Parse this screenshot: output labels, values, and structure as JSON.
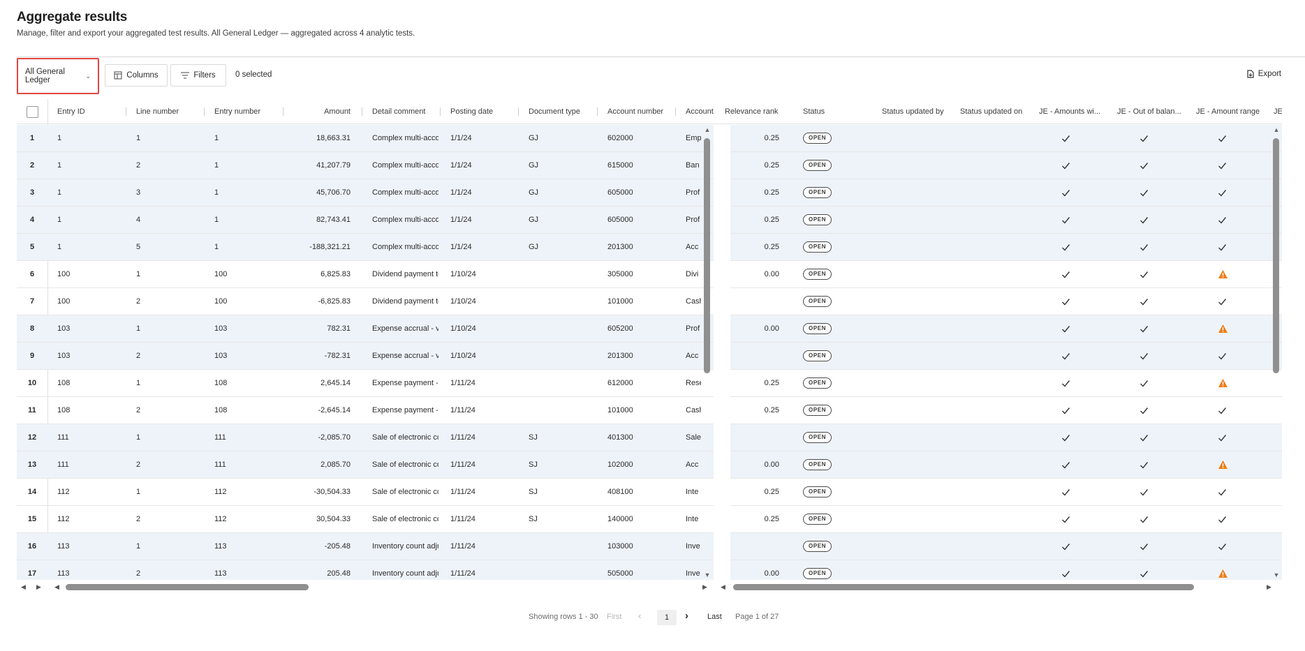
{
  "page": {
    "title": "Aggregate results",
    "subtitle": "Manage, filter and export your aggregated test results. All General Ledger — aggregated across 4 analytic tests."
  },
  "toolbar": {
    "dataset_label": "All General Ledger",
    "columns_label": "Columns",
    "filters_label": "Filters",
    "selected_text": "0 selected",
    "export_label": "Export"
  },
  "columns": [
    "Entry ID",
    "Line number",
    "Entry number",
    "Amount",
    "Detail comment",
    "Posting date",
    "Document type",
    "Account number",
    "Account",
    "Relevance rank",
    "Status",
    "Status updated by",
    "Status updated on",
    "JE - Amounts wi...",
    "JE - Out of balan...",
    "JE - Amount range",
    "JE -"
  ],
  "rows": [
    {
      "n": "1",
      "entry_id": "1",
      "line": "1",
      "entry_no": "1",
      "amount": "18,663.31",
      "detail": "Complex multi-accou",
      "date": "1/1/24",
      "doc": "GJ",
      "acct_no": "602000",
      "acct": "Emp",
      "rank": "0.25",
      "status": "OPEN",
      "t1": "check",
      "t2": "check",
      "t3": "check"
    },
    {
      "n": "2",
      "entry_id": "1",
      "line": "2",
      "entry_no": "1",
      "amount": "41,207.79",
      "detail": "Complex multi-accou",
      "date": "1/1/24",
      "doc": "GJ",
      "acct_no": "615000",
      "acct": "Ban",
      "rank": "0.25",
      "status": "OPEN",
      "t1": "check",
      "t2": "check",
      "t3": "check"
    },
    {
      "n": "3",
      "entry_id": "1",
      "line": "3",
      "entry_no": "1",
      "amount": "45,706.70",
      "detail": "Complex multi-accou",
      "date": "1/1/24",
      "doc": "GJ",
      "acct_no": "605000",
      "acct": "Prof",
      "rank": "0.25",
      "status": "OPEN",
      "t1": "check",
      "t2": "check",
      "t3": "check"
    },
    {
      "n": "4",
      "entry_id": "1",
      "line": "4",
      "entry_no": "1",
      "amount": "82,743.41",
      "detail": "Complex multi-accou",
      "date": "1/1/24",
      "doc": "GJ",
      "acct_no": "605000",
      "acct": "Prof",
      "rank": "0.25",
      "status": "OPEN",
      "t1": "check",
      "t2": "check",
      "t3": "check"
    },
    {
      "n": "5",
      "entry_id": "1",
      "line": "5",
      "entry_no": "1",
      "amount": "-188,321.21",
      "detail": "Complex multi-accou",
      "date": "1/1/24",
      "doc": "GJ",
      "acct_no": "201300",
      "acct": "Acc",
      "rank": "0.25",
      "status": "OPEN",
      "t1": "check",
      "t2": "check",
      "t3": "check"
    },
    {
      "n": "6",
      "entry_id": "100",
      "line": "1",
      "entry_no": "100",
      "amount": "6,825.83",
      "detail": "Dividend payment to",
      "date": "1/10/24",
      "doc": "",
      "acct_no": "305000",
      "acct": "Divi",
      "rank": "0.00",
      "status": "OPEN",
      "t1": "check",
      "t2": "check",
      "t3": "warn"
    },
    {
      "n": "7",
      "entry_id": "100",
      "line": "2",
      "entry_no": "100",
      "amount": "-6,825.83",
      "detail": "Dividend payment to",
      "date": "1/10/24",
      "doc": "",
      "acct_no": "101000",
      "acct": "Cash",
      "rank": "",
      "status": "OPEN",
      "t1": "check",
      "t2": "check",
      "t3": "check"
    },
    {
      "n": "8",
      "entry_id": "103",
      "line": "1",
      "entry_no": "103",
      "amount": "782.31",
      "detail": "Expense accrual - ver",
      "date": "1/10/24",
      "doc": "",
      "acct_no": "605200",
      "acct": "Prof",
      "rank": "0.00",
      "status": "OPEN",
      "t1": "check",
      "t2": "check",
      "t3": "warn"
    },
    {
      "n": "9",
      "entry_id": "103",
      "line": "2",
      "entry_no": "103",
      "amount": "-782.31",
      "detail": "Expense accrual - ver",
      "date": "1/10/24",
      "doc": "",
      "acct_no": "201300",
      "acct": "Acc",
      "rank": "",
      "status": "OPEN",
      "t1": "check",
      "t2": "check",
      "t3": "check"
    },
    {
      "n": "10",
      "entry_id": "108",
      "line": "1",
      "entry_no": "108",
      "amount": "2,645.14",
      "detail": "Expense payment - ve",
      "date": "1/11/24",
      "doc": "",
      "acct_no": "612000",
      "acct": "Rese",
      "rank": "0.25",
      "status": "OPEN",
      "t1": "check",
      "t2": "check",
      "t3": "warn"
    },
    {
      "n": "11",
      "entry_id": "108",
      "line": "2",
      "entry_no": "108",
      "amount": "-2,645.14",
      "detail": "Expense payment - ve",
      "date": "1/11/24",
      "doc": "",
      "acct_no": "101000",
      "acct": "Cash",
      "rank": "0.25",
      "status": "OPEN",
      "t1": "check",
      "t2": "check",
      "t3": "check"
    },
    {
      "n": "12",
      "entry_id": "111",
      "line": "1",
      "entry_no": "111",
      "amount": "-2,085.70",
      "detail": "Sale of electronic con",
      "date": "1/11/24",
      "doc": "SJ",
      "acct_no": "401300",
      "acct": "Sale",
      "rank": "",
      "status": "OPEN",
      "t1": "check",
      "t2": "check",
      "t3": "check"
    },
    {
      "n": "13",
      "entry_id": "111",
      "line": "2",
      "entry_no": "111",
      "amount": "2,085.70",
      "detail": "Sale of electronic con",
      "date": "1/11/24",
      "doc": "SJ",
      "acct_no": "102000",
      "acct": "Acc",
      "rank": "0.00",
      "status": "OPEN",
      "t1": "check",
      "t2": "check",
      "t3": "warn"
    },
    {
      "n": "14",
      "entry_id": "112",
      "line": "1",
      "entry_no": "112",
      "amount": "-30,504.33",
      "detail": "Sale of electronic con",
      "date": "1/11/24",
      "doc": "SJ",
      "acct_no": "408100",
      "acct": "Inte",
      "rank": "0.25",
      "status": "OPEN",
      "t1": "check",
      "t2": "check",
      "t3": "check"
    },
    {
      "n": "15",
      "entry_id": "112",
      "line": "2",
      "entry_no": "112",
      "amount": "30,504.33",
      "detail": "Sale of electronic con",
      "date": "1/11/24",
      "doc": "SJ",
      "acct_no": "140000",
      "acct": "Inte",
      "rank": "0.25",
      "status": "OPEN",
      "t1": "check",
      "t2": "check",
      "t3": "check"
    },
    {
      "n": "16",
      "entry_id": "113",
      "line": "1",
      "entry_no": "113",
      "amount": "-205.48",
      "detail": "Inventory count adjus",
      "date": "1/11/24",
      "doc": "",
      "acct_no": "103000",
      "acct": "Inve",
      "rank": "",
      "status": "OPEN",
      "t1": "check",
      "t2": "check",
      "t3": "check"
    },
    {
      "n": "17",
      "entry_id": "113",
      "line": "2",
      "entry_no": "113",
      "amount": "205.48",
      "detail": "Inventory count adjus",
      "date": "1/11/24",
      "doc": "",
      "acct_no": "505000",
      "acct": "Inve",
      "rank": "0.00",
      "status": "OPEN",
      "t1": "check",
      "t2": "check",
      "t3": "warn"
    }
  ],
  "pagination": {
    "showing": "Showing rows 1 - 30",
    "first": "First",
    "current": "1",
    "last": "Last",
    "page_of": "Page 1 of 27"
  },
  "colors": {
    "highlight_border": "#e0473f",
    "row_alt": "#eef3f9",
    "warning": "#ef7d16"
  },
  "icons": {
    "dataset": "chevron-down-icon",
    "columns": "columns-icon",
    "filters": "filter-icon",
    "export": "export-icon",
    "check": "check-icon",
    "warn": "warning-icon"
  }
}
